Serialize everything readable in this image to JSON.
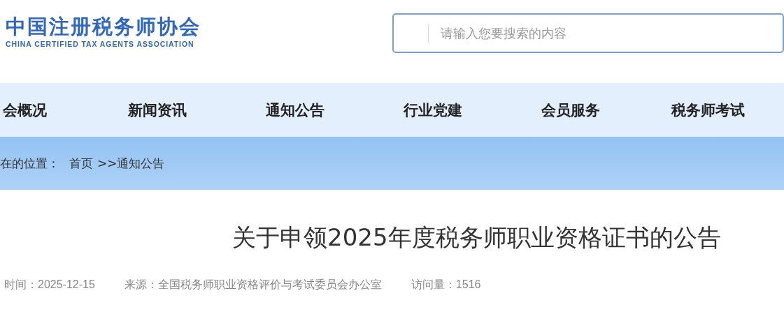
{
  "logo": {
    "name": "中国注册税务师协会",
    "subtitle": "CHINA CERTIFIED TAX AGENTS ASSOCIATION"
  },
  "search": {
    "placeholder": "请输入您要搜索的内容"
  },
  "nav": [
    {
      "label": "会概况"
    },
    {
      "label": "新闻资讯"
    },
    {
      "label": "通知公告"
    },
    {
      "label": "行业党建"
    },
    {
      "label": "会员服务"
    },
    {
      "label": "税务师考试"
    }
  ],
  "breadcrumb": {
    "prefix": "在的位置：",
    "home": "首页",
    "current": ">>通知公告"
  },
  "article": {
    "title": "关于申领2025年度税务师职业资格证书的公告",
    "meta": [
      "时间：2025-12-15",
      "来源：全国税务师职业资格评价与考试委员会办公室",
      "访问量：1516"
    ]
  }
}
